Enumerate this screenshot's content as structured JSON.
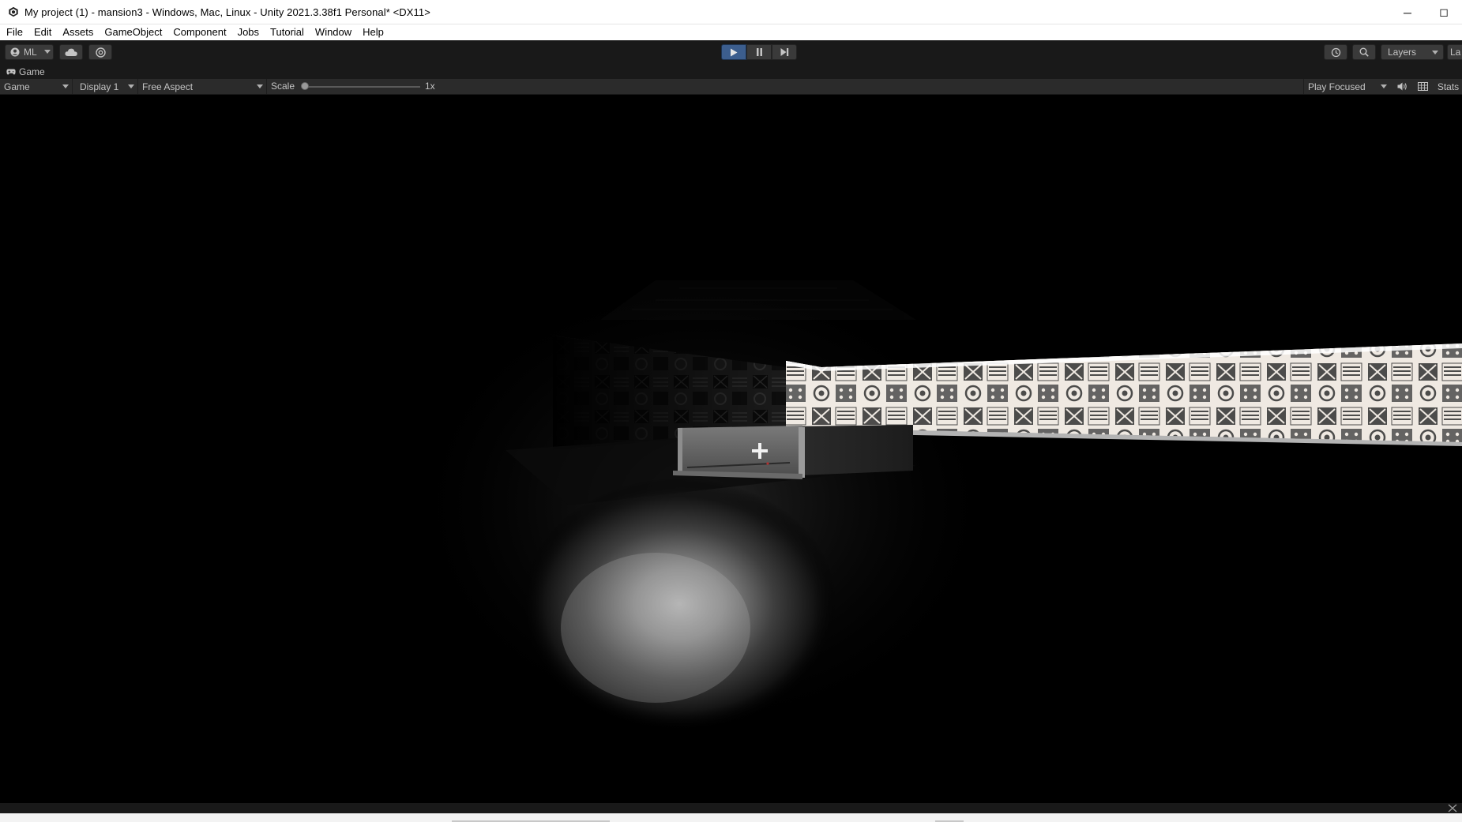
{
  "window": {
    "title": "My project (1) - mansion3 - Windows, Mac, Linux - Unity 2021.3.38f1 Personal* <DX11>",
    "minimize_glyph": "─",
    "maximize_glyph": "◻"
  },
  "menu": [
    "File",
    "Edit",
    "Assets",
    "GameObject",
    "Component",
    "Jobs",
    "Tutorial",
    "Window",
    "Help"
  ],
  "toolbar": {
    "account_label": "ML",
    "account_icon": "account-icon",
    "cloud_icon": "cloud-icon",
    "collab_icon": "collab-icon",
    "play_active": true,
    "layers_label": "Layers",
    "layout_label": "La",
    "accent_color": "#3c5e8e"
  },
  "game_tab": {
    "label": "Game",
    "icon": "gamepad-icon"
  },
  "game_toolbar": {
    "view_mode": "Game",
    "display": "Display 1",
    "aspect": "Free Aspect",
    "scale_label": "Scale",
    "scale_value": "1x",
    "play_mode": "Play Focused",
    "stats_label": "Stats"
  }
}
